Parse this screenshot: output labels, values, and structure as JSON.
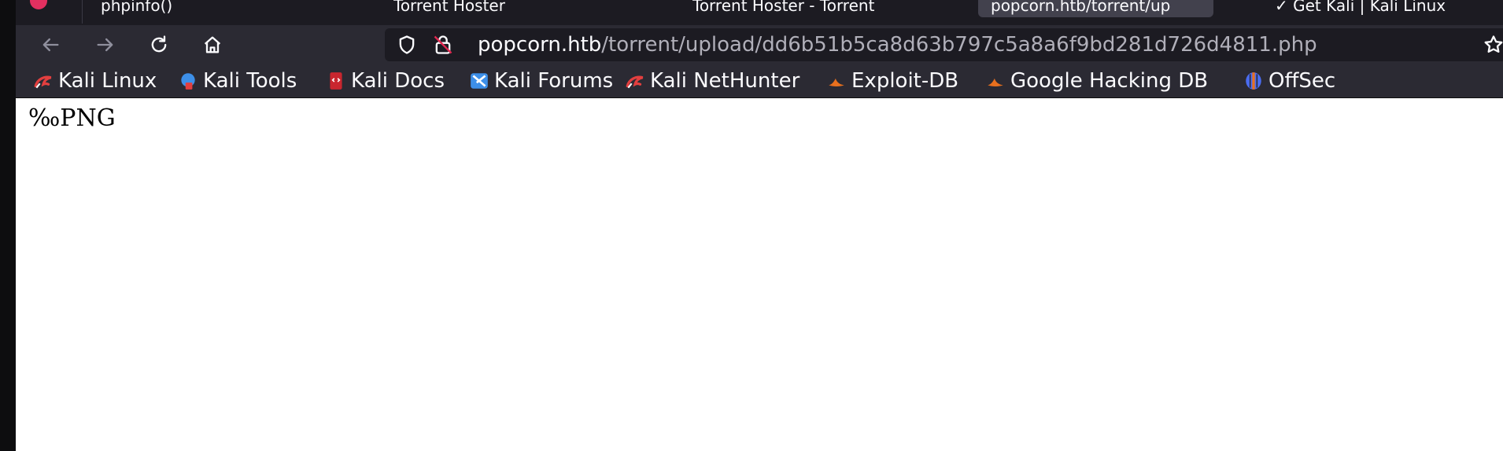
{
  "tabs": [
    {
      "label": "phpinfo()",
      "active": false
    },
    {
      "label": "Torrent Hoster",
      "active": false
    },
    {
      "label": "Torrent Hoster - Torrent",
      "active": false
    },
    {
      "label": "popcorn.htb/torrent/up",
      "active": true
    },
    {
      "label": "✓ Get Kali | Kali Linux",
      "active": false
    }
  ],
  "navbar": {
    "back_icon": "back-arrow-icon",
    "forward_icon": "forward-arrow-icon",
    "reload_icon": "reload-icon",
    "home_icon": "home-icon"
  },
  "url": {
    "host": "popcorn.htb",
    "path": "/torrent/upload/dd6b51b5ca8d63b797c5a8a6f9bd281d726d4811.php"
  },
  "bookmarks": [
    {
      "label": "Kali Linux",
      "icon": "kali-dragon-icon",
      "color": "#e33f3f"
    },
    {
      "label": "Kali Tools",
      "icon": "kali-tools-icon",
      "color": "#3d8fe8"
    },
    {
      "label": "Kali Docs",
      "icon": "kali-docs-icon",
      "color": "#c9262f"
    },
    {
      "label": "Kali Forums",
      "icon": "kali-forums-icon",
      "color": "#3d8fe8"
    },
    {
      "label": "Kali NetHunter",
      "icon": "kali-nethunter-icon",
      "color": "#e33f3f"
    },
    {
      "label": "Exploit-DB",
      "icon": "exploit-db-icon",
      "color": "#e8701e"
    },
    {
      "label": "Google Hacking DB",
      "icon": "ghdb-icon",
      "color": "#e8701e"
    },
    {
      "label": "OffSec",
      "icon": "offsec-icon",
      "color": "#4a6cf0"
    }
  ],
  "content": {
    "text": "‰PNG"
  },
  "colors": {
    "tabstrip": "#1c1b22",
    "toolbar": "#2b2a33",
    "urlbar": "#1c1b22",
    "page": "#ffffff"
  }
}
